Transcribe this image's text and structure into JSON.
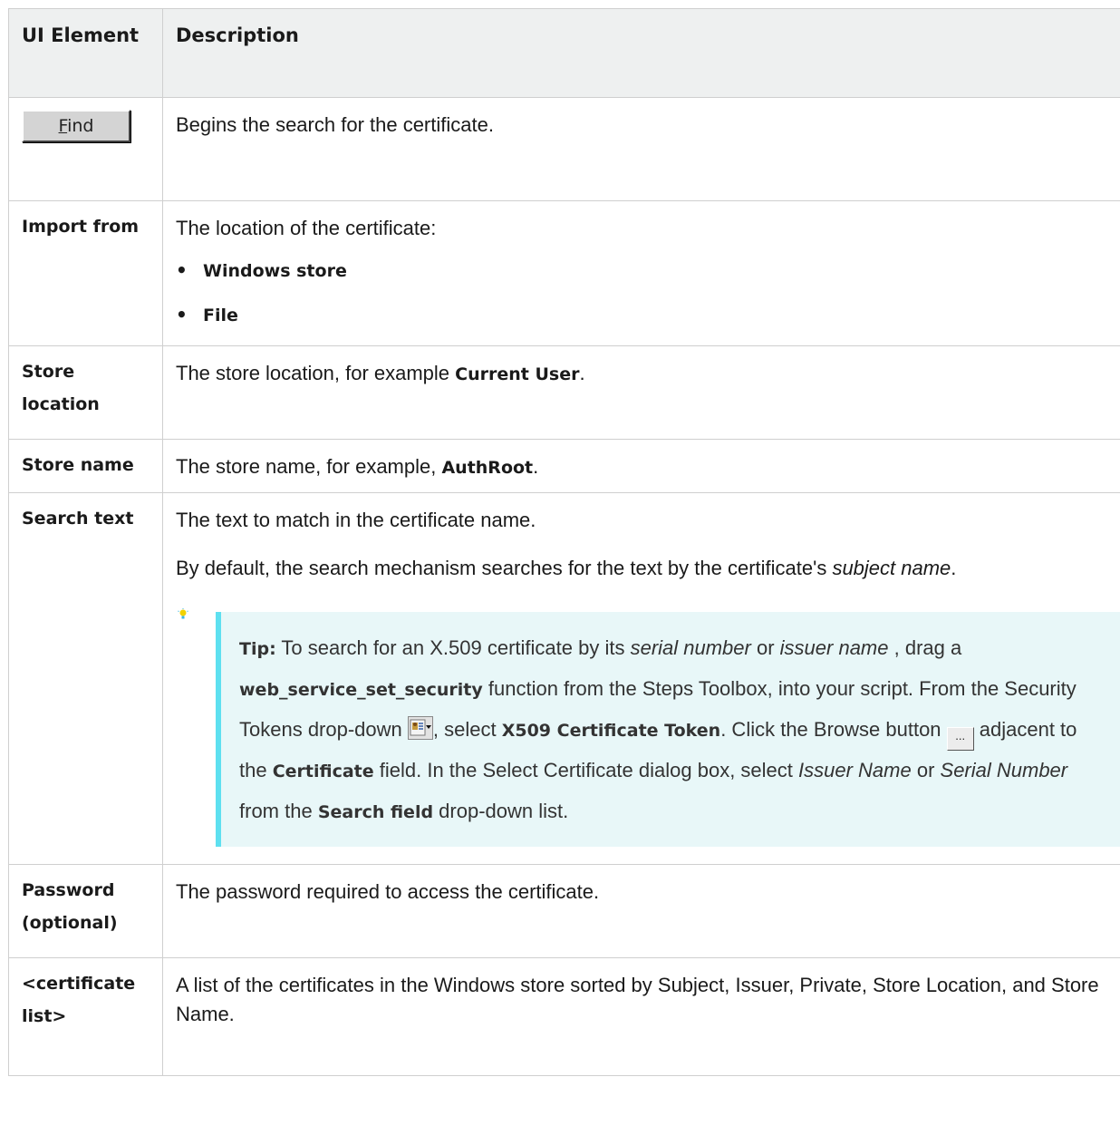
{
  "header": {
    "col1": "UI Element",
    "col2": "Description"
  },
  "rows": {
    "find": {
      "button_label_underlined": "F",
      "button_label_rest": "ind",
      "desc": "Begins the search for the certificate."
    },
    "import_from": {
      "label": "Import from",
      "desc": "The location of the certificate:",
      "options": [
        "Windows store",
        "File"
      ]
    },
    "store_location": {
      "label": "Store location",
      "desc_pre": "The store location, for example ",
      "desc_bold": "Current User",
      "desc_post": "."
    },
    "store_name": {
      "label": "Store name",
      "desc_pre": "The store name, for example, ",
      "desc_bold": "AuthRoot",
      "desc_post": "."
    },
    "search_text": {
      "label": "Search text",
      "desc": "The text to match in the certificate name.",
      "para2_pre": "By default, the search mechanism searches for the text by the certificate's ",
      "para2_italic": "subject name",
      "para2_post": ".",
      "tip": {
        "label": "Tip:",
        "t1": " To search for an X.509 certificate by its ",
        "i1": "serial number",
        "t2": " or ",
        "i2": "issuer name",
        "t3": " , drag a ",
        "b1": "web_service_set_security",
        "t4": " function from the Steps Toolbox, into your script. From the Security Tokens drop-down ",
        "t5": ", select ",
        "b2": "X509 Certificate Token",
        "t6": ". Click the Browse button ",
        "browse_glyph": "...",
        "t7": " adjacent to the ",
        "b3": "Certificate",
        "t8": " field. In the Select Certificate dialog box, select ",
        "i3": "Issuer Name",
        "t9": " or ",
        "i4": "Serial Number",
        "t10": " from the ",
        "b4": "Search field",
        "t11": " drop-down list."
      }
    },
    "password": {
      "label": "Password (optional)",
      "desc": "The password required to access the certificate."
    },
    "cert_list": {
      "label": "<certificate list>",
      "desc": "A list of the certificates in the Windows store sorted by Subject, Issuer, Private, Store Location, and Store Name."
    }
  },
  "icons": {
    "bullet": "•",
    "tip_icon": "lightbulb-icon",
    "security_tokens_icon": "security-tokens-dropdown-icon",
    "browse_icon": "browse-button-icon"
  },
  "colors": {
    "header_bg": "#eef0f0",
    "tip_bg": "#e8f7f8",
    "tip_border": "#5ee0f0",
    "grid": "#cfcfcf"
  }
}
